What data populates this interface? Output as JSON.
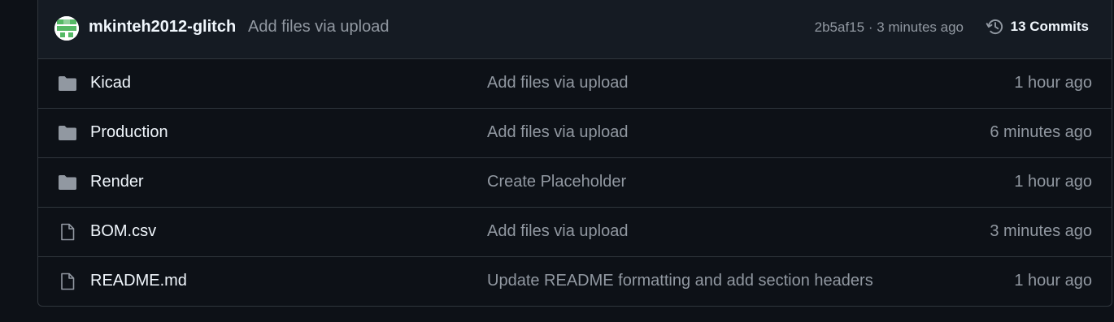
{
  "header": {
    "author": "mkinteh2012-glitch",
    "message": "Add files via upload",
    "sha": "2b5af15",
    "separator": " · ",
    "time": "3 minutes ago",
    "commits_label": "13 Commits"
  },
  "files": [
    {
      "name": "Kicad",
      "type": "folder",
      "message": "Add files via upload",
      "time": "1 hour ago"
    },
    {
      "name": "Production",
      "type": "folder",
      "message": "Add files via upload",
      "time": "6 minutes ago"
    },
    {
      "name": "Render",
      "type": "folder",
      "message": "Create Placeholder",
      "time": "1 hour ago"
    },
    {
      "name": "BOM.csv",
      "type": "file",
      "message": "Add files via upload",
      "time": "3 minutes ago"
    },
    {
      "name": "README.md",
      "type": "file",
      "message": "Update README formatting and add section headers",
      "time": "1 hour ago"
    }
  ],
  "colors": {
    "background": "#0d1117",
    "header_background": "#151b23",
    "border": "#30363d",
    "primary_text": "#f0f6fc",
    "muted_text": "#9198a1",
    "icon": "#9198a1",
    "avatar_accent": "#3fb950"
  }
}
